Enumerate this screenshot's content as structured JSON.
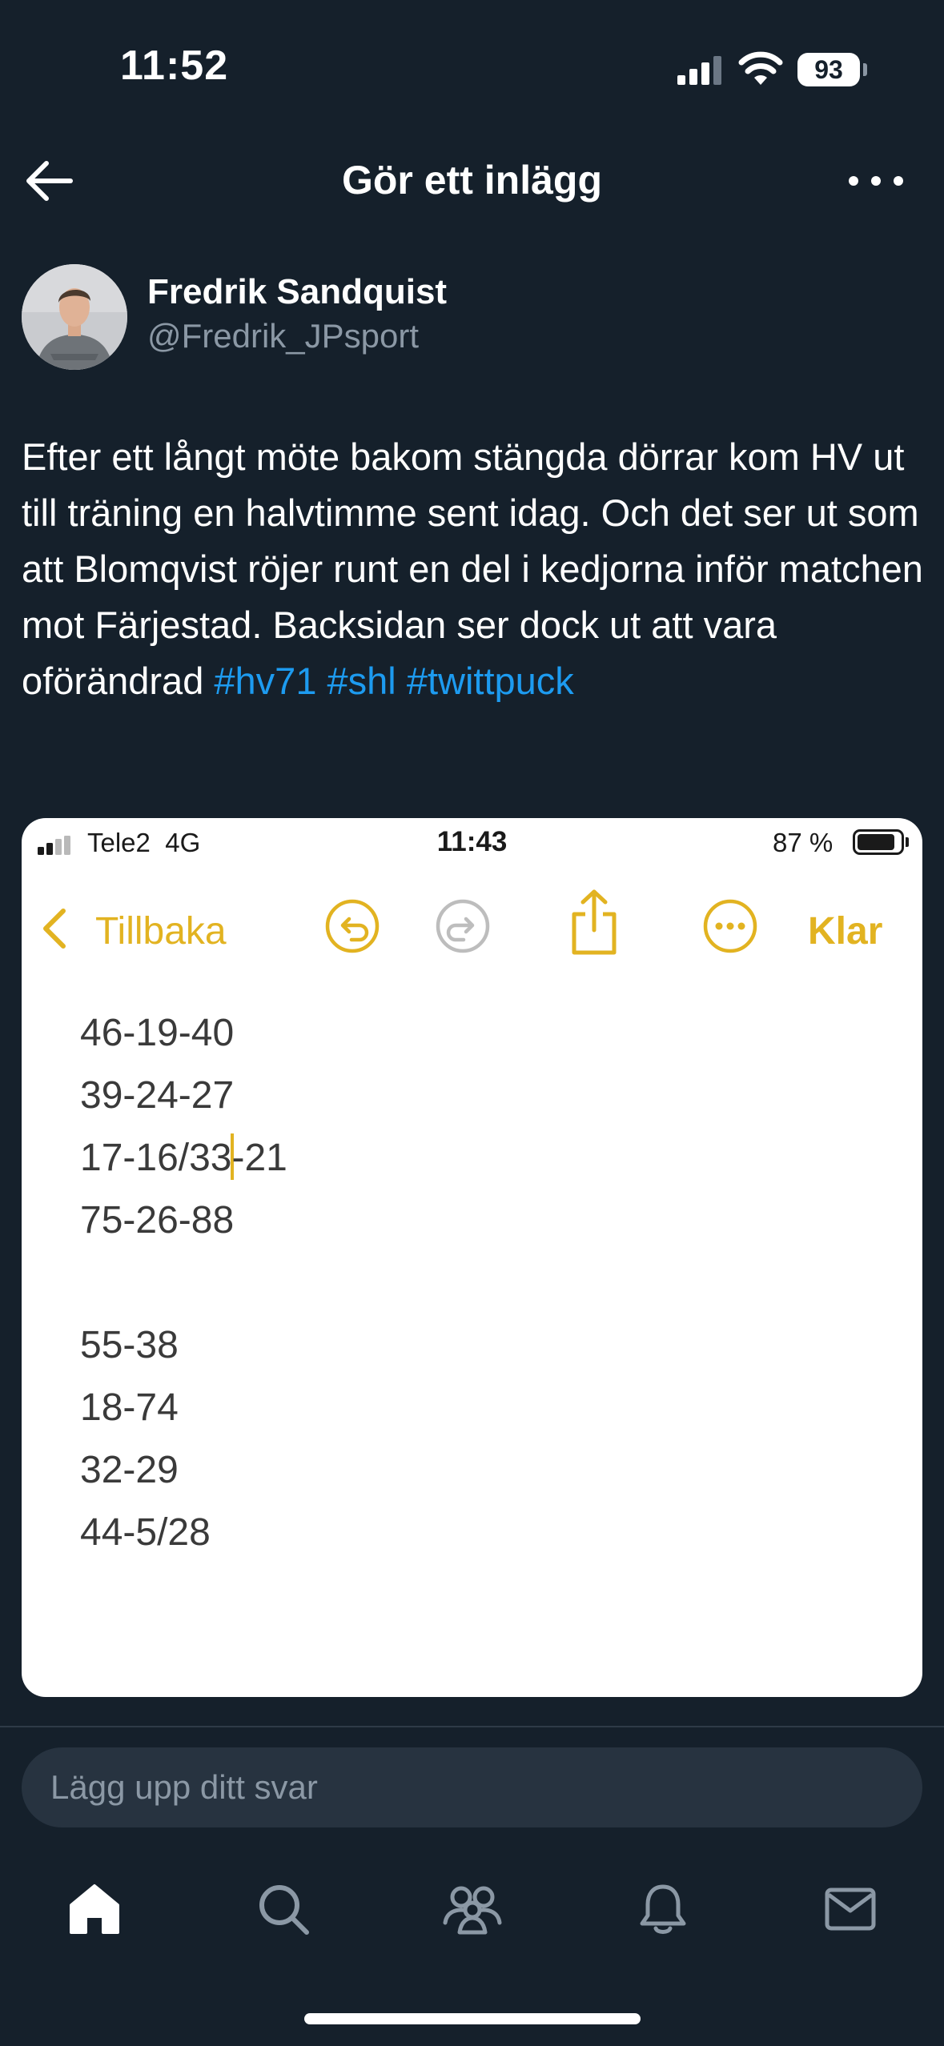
{
  "status_bar": {
    "time": "11:52",
    "battery": "93"
  },
  "header": {
    "title": "Gör ett inlägg",
    "back_icon": "arrow-left-icon",
    "more_icon": "more-horizontal-icon"
  },
  "author": {
    "name": "Fredrik Sandquist",
    "handle": "@Fredrik_JPsport"
  },
  "post": {
    "text": "Efter ett långt möte bakom stängda dörrar kom HV ut till träning en halvtimme sent idag. Och det ser ut som att Blomqvist röjer runt en del i kedjorna inför matchen mot Färjestad. Backsidan ser dock ut att vara oförändrad",
    "hashtags": [
      "#hv71",
      "#shl",
      "#twittpuck"
    ]
  },
  "screenshot": {
    "status": {
      "carrier": "Tele2",
      "network": "4G",
      "time": "11:43",
      "battery": "87 %"
    },
    "toolbar": {
      "back_label": "Tillbaka",
      "done_label": "Klar",
      "accent_color": "#e2b321"
    },
    "lines_before_caret": [
      "46-19-40",
      "39-24-27"
    ],
    "caret_line": {
      "before": "17-16/33",
      "after": "-21"
    },
    "lines_after_caret": [
      "75-26-88",
      "",
      "55-38",
      "18-74",
      "32-29",
      "44-5/28"
    ]
  },
  "reply": {
    "placeholder": "Lägg upp ditt svar"
  },
  "tabs": [
    {
      "name": "home",
      "icon": "home-icon"
    },
    {
      "name": "search",
      "icon": "search-icon"
    },
    {
      "name": "communities",
      "icon": "people-icon"
    },
    {
      "name": "notifications",
      "icon": "bell-icon"
    },
    {
      "name": "messages",
      "icon": "envelope-icon"
    }
  ],
  "colors": {
    "background": "#15202b",
    "link": "#1d9bf0",
    "muted": "#8b98a5"
  }
}
